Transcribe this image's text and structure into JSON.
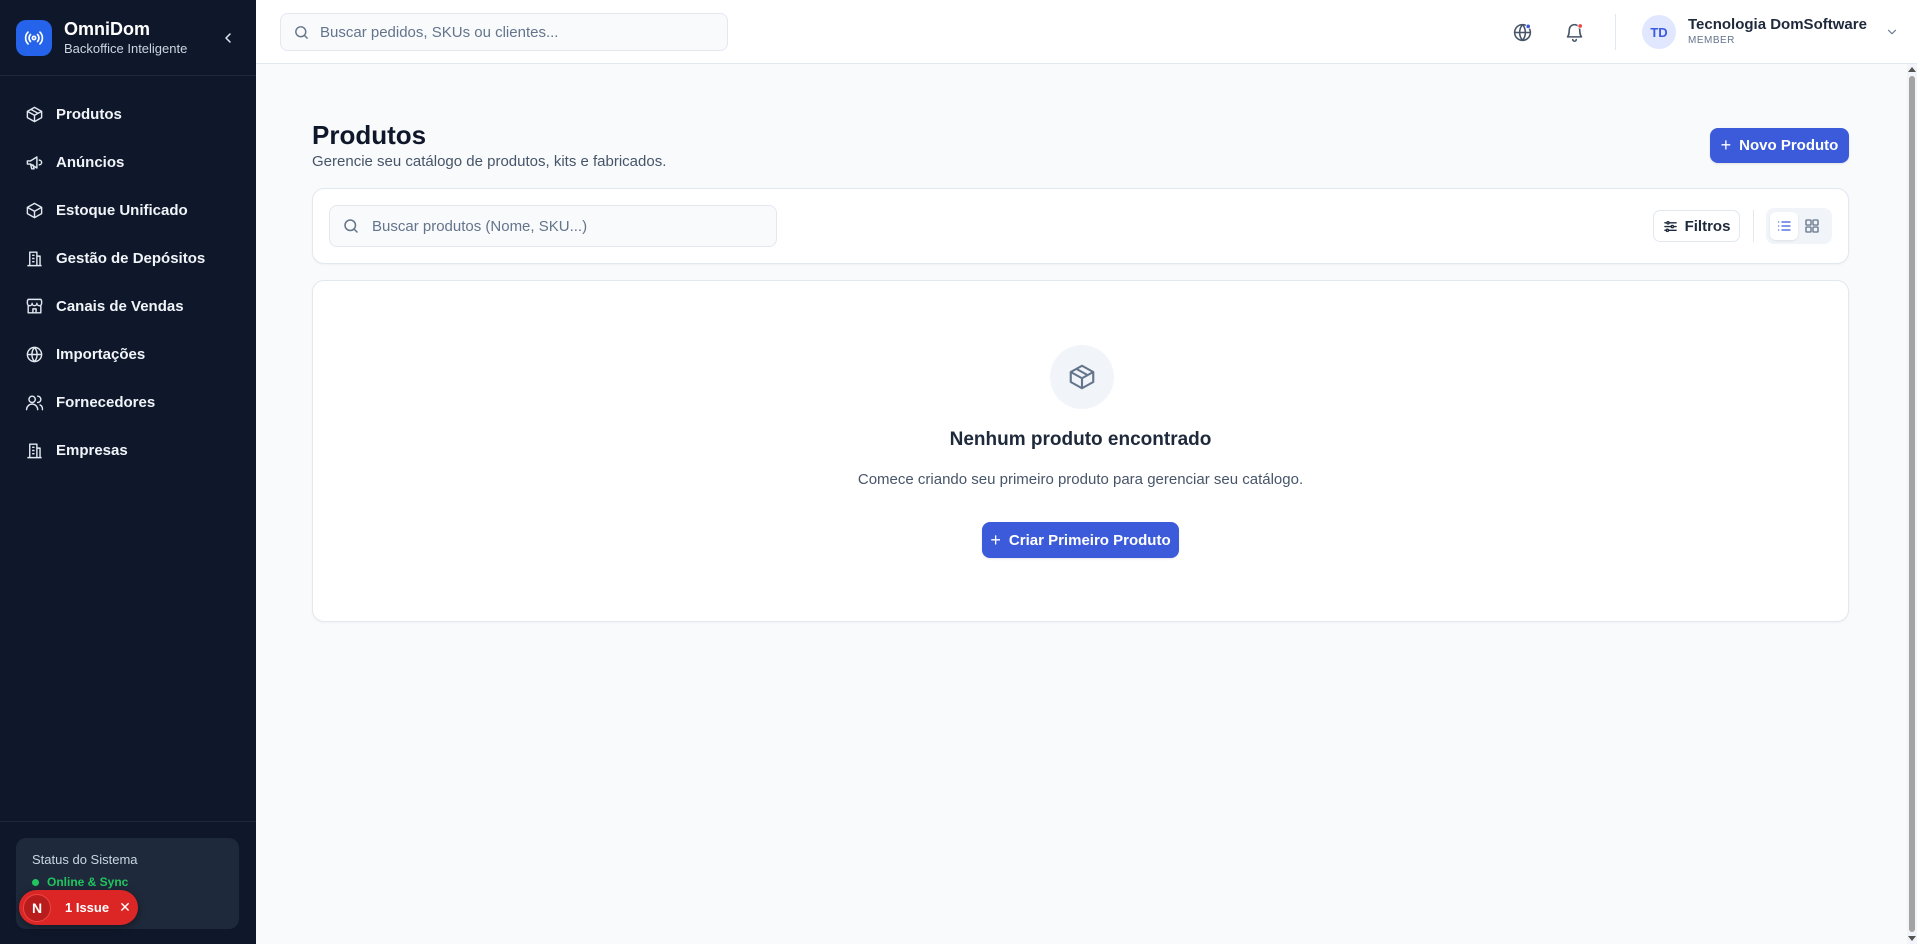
{
  "app": {
    "name": "OmniDom",
    "subtitle": "Backoffice Inteligente"
  },
  "sidebar": {
    "items": [
      {
        "label": "Produtos",
        "icon": "package-icon"
      },
      {
        "label": "Anúncios",
        "icon": "megaphone-icon"
      },
      {
        "label": "Estoque Unificado",
        "icon": "box-icon"
      },
      {
        "label": "Gestão de Depósitos",
        "icon": "warehouse-icon"
      },
      {
        "label": "Canais de Vendas",
        "icon": "store-icon"
      },
      {
        "label": "Importações",
        "icon": "globe-icon"
      },
      {
        "label": "Fornecedores",
        "icon": "users-icon"
      },
      {
        "label": "Empresas",
        "icon": "building-icon"
      }
    ],
    "status": {
      "title": "Status do Sistema",
      "value": "Online & Sync"
    }
  },
  "issue_badge": {
    "letter": "N",
    "label": "1 Issue"
  },
  "header": {
    "search_placeholder": "Buscar pedidos, SKUs ou clientes...",
    "user": {
      "initials": "TD",
      "name": "Tecnologia DomSoftware",
      "role": "MEMBER"
    }
  },
  "main": {
    "title": "Produtos",
    "subtitle": "Gerencie seu catálogo de produtos, kits e fabricados.",
    "new_button": "Novo Produto",
    "search_placeholder": "Buscar produtos (Nome, SKU...)",
    "filter_label": "Filtros",
    "empty": {
      "title": "Nenhum produto encontrado",
      "text": "Comece criando seu primeiro produto para gerenciar seu catálogo.",
      "button": "Criar Primeiro Produto"
    }
  },
  "colors": {
    "sidebar_bg": "#0f172a",
    "accent": "#3b5bdb",
    "brand": "#2563eb",
    "status_ok": "#22c55e",
    "issue": "#dc2626"
  }
}
